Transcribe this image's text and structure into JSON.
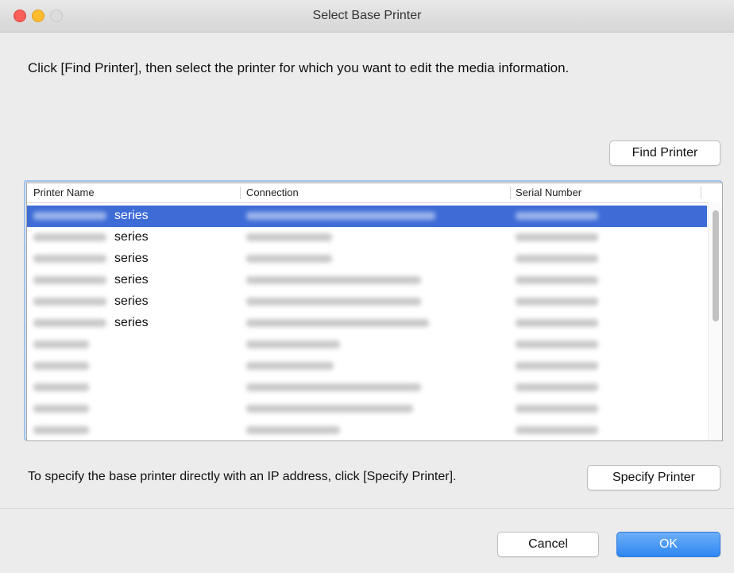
{
  "window": {
    "title": "Select Base Printer"
  },
  "instruction": "Click [Find Printer], then select the printer for which you want to edit the media information.",
  "buttons": {
    "find": "Find Printer",
    "specify": "Specify Printer",
    "cancel": "Cancel",
    "ok": "OK"
  },
  "table": {
    "columns": [
      "Printer Name",
      "Connection",
      "Serial Number"
    ],
    "rows": [
      {
        "name_suffix": "series",
        "selected": true
      },
      {
        "name_suffix": "series",
        "selected": false
      },
      {
        "name_suffix": "series",
        "selected": false
      },
      {
        "name_suffix": "series",
        "selected": false
      },
      {
        "name_suffix": "series",
        "selected": false
      },
      {
        "name_suffix": "series",
        "selected": false
      },
      {
        "name_suffix": "",
        "selected": false
      },
      {
        "name_suffix": "",
        "selected": false
      },
      {
        "name_suffix": "",
        "selected": false
      },
      {
        "name_suffix": "",
        "selected": false
      },
      {
        "name_suffix": "",
        "selected": false
      }
    ]
  },
  "ip_hint": "To specify the base printer directly with an IP address, click [Specify Printer].",
  "colors": {
    "selection": "#3e6cd6",
    "ok_button": "#2e87f2",
    "close": "#fc5f57",
    "minimize": "#fdbc2e"
  }
}
